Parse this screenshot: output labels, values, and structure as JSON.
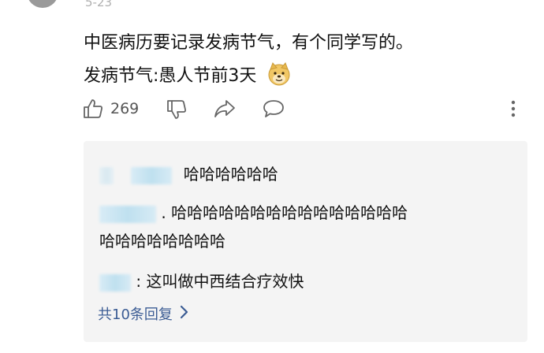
{
  "comment": {
    "date": "5-23",
    "line1": "中医病历要记录发病节气，有个同学写的。",
    "line2": "发病节气:愚人节前3天",
    "emoji_icon": "doge-emoji"
  },
  "actions": {
    "like_count": "269",
    "like_icon": "thumb-up-icon",
    "dislike_icon": "thumb-down-icon",
    "share_icon": "share-icon",
    "reply_icon": "comment-icon",
    "more_icon": "more-vertical-icon"
  },
  "replies": {
    "items": [
      {
        "text": "哈哈哈哈哈哈"
      },
      {
        "text": ". 哈哈哈哈哈哈哈哈哈哈哈哈哈哈哈"
      },
      {
        "text": "哈哈哈哈哈哈哈哈"
      },
      {
        "text": ": 这叫做中西结合疗效快"
      }
    ],
    "more_label": "共10条回复",
    "link_color": "#3b5c94"
  }
}
